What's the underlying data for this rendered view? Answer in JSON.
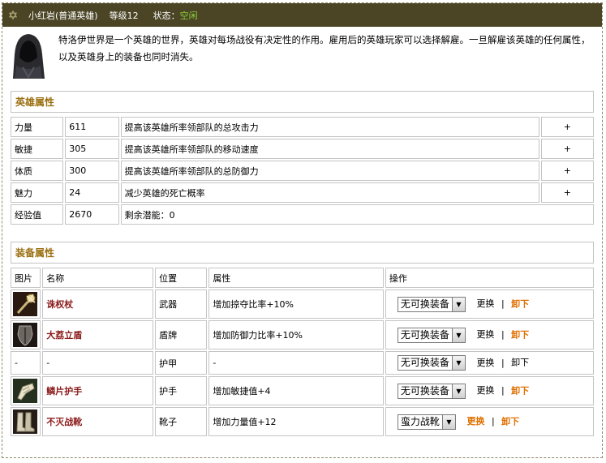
{
  "title": {
    "hero_name": "小红岩(普通英雄)",
    "level": "等级12",
    "status_label": "状态：",
    "status_value": "空闲"
  },
  "description": "特洛伊世界是一个英雄的世界，英雄对每场战役有决定性的作用。雇用后的英雄玩家可以选择解雇。一旦解雇该英雄的任何属性，以及英雄身上的装备也同时消失。",
  "attr_section": {
    "title": "英雄属性",
    "rows": [
      {
        "name": "力量",
        "value": "611",
        "desc": "提高该英雄所率领部队的总攻击力",
        "action": "+"
      },
      {
        "name": "敏捷",
        "value": "305",
        "desc": "提高该英雄所率领部队的移动速度",
        "action": "+"
      },
      {
        "name": "体质",
        "value": "300",
        "desc": "提高该英雄所率领部队的总防御力",
        "action": "+"
      },
      {
        "name": "魅力",
        "value": "24",
        "desc": "减少英雄的死亡概率",
        "action": "+"
      }
    ],
    "exp_label": "经验值",
    "exp_value": "2670",
    "potential": "剩余潜能：0"
  },
  "equip_section": {
    "title": "装备属性",
    "headers": [
      "图片",
      "名称",
      "位置",
      "属性",
      "操作"
    ],
    "rows": [
      {
        "name": "诛权杖",
        "slot": "武器",
        "attr": "增加掠夺比率+10%",
        "select": "无可换装备",
        "change": "更换",
        "unload": "卸下"
      },
      {
        "name": "大荔立盾",
        "slot": "盾牌",
        "attr": "增加防御力比率+10%",
        "select": "无可换装备",
        "change": "更换",
        "unload": "卸下"
      },
      {
        "name": "-",
        "slot": "护甲",
        "attr": "-",
        "select": "无可换装备",
        "change": "更换",
        "unload": "卸下",
        "pic": "-"
      },
      {
        "name": "鳞片护手",
        "slot": "护手",
        "attr": "增加敏捷值+4",
        "select": "无可换装备",
        "change": "更换",
        "unload": "卸下"
      },
      {
        "name": "不灭战靴",
        "slot": "靴子",
        "attr": "增加力量值+12",
        "select": "蛮力战靴",
        "change": "更换",
        "unload": "卸下"
      }
    ],
    "separator": "|"
  },
  "colors": {
    "titlebar_bg": "#4b4526",
    "status_green": "#8bd03a",
    "section_title": "#9a6f10",
    "equip_name": "#8b1a1a",
    "unload_orange": "#e07000"
  }
}
